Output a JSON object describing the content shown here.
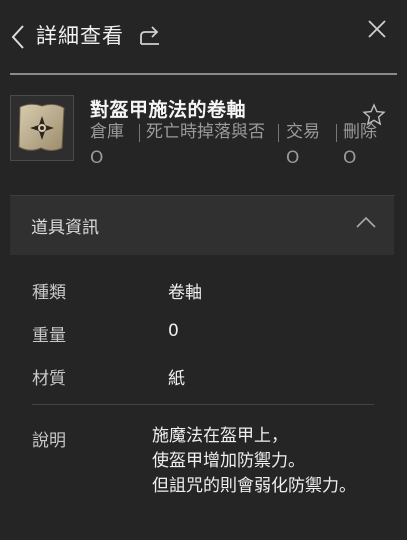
{
  "header": {
    "title": "詳細查看"
  },
  "item": {
    "name": "對盔甲施法的卷軸",
    "icon": "scroll-icon",
    "properties": [
      {
        "label": "倉庫",
        "value": "O"
      },
      {
        "label": "死亡時掉落與否",
        "value": "O"
      },
      {
        "label": "交易",
        "value": "O"
      },
      {
        "label": "刪除",
        "value": "O"
      }
    ]
  },
  "section": {
    "title": "道具資訊"
  },
  "details": {
    "type_label": "種類",
    "type_value": "卷軸",
    "weight_label": "重量",
    "weight_value": "0",
    "material_label": "材質",
    "material_value": "紙",
    "desc_label": "說明",
    "desc_lines": [
      "施魔法在盔甲上，",
      "使盔甲增加防禦力。",
      "但詛咒的則會弱化防禦力。"
    ]
  },
  "colors": {
    "background": "#252525",
    "section_header": "#303030",
    "muted_text": "#9a9a9a"
  }
}
